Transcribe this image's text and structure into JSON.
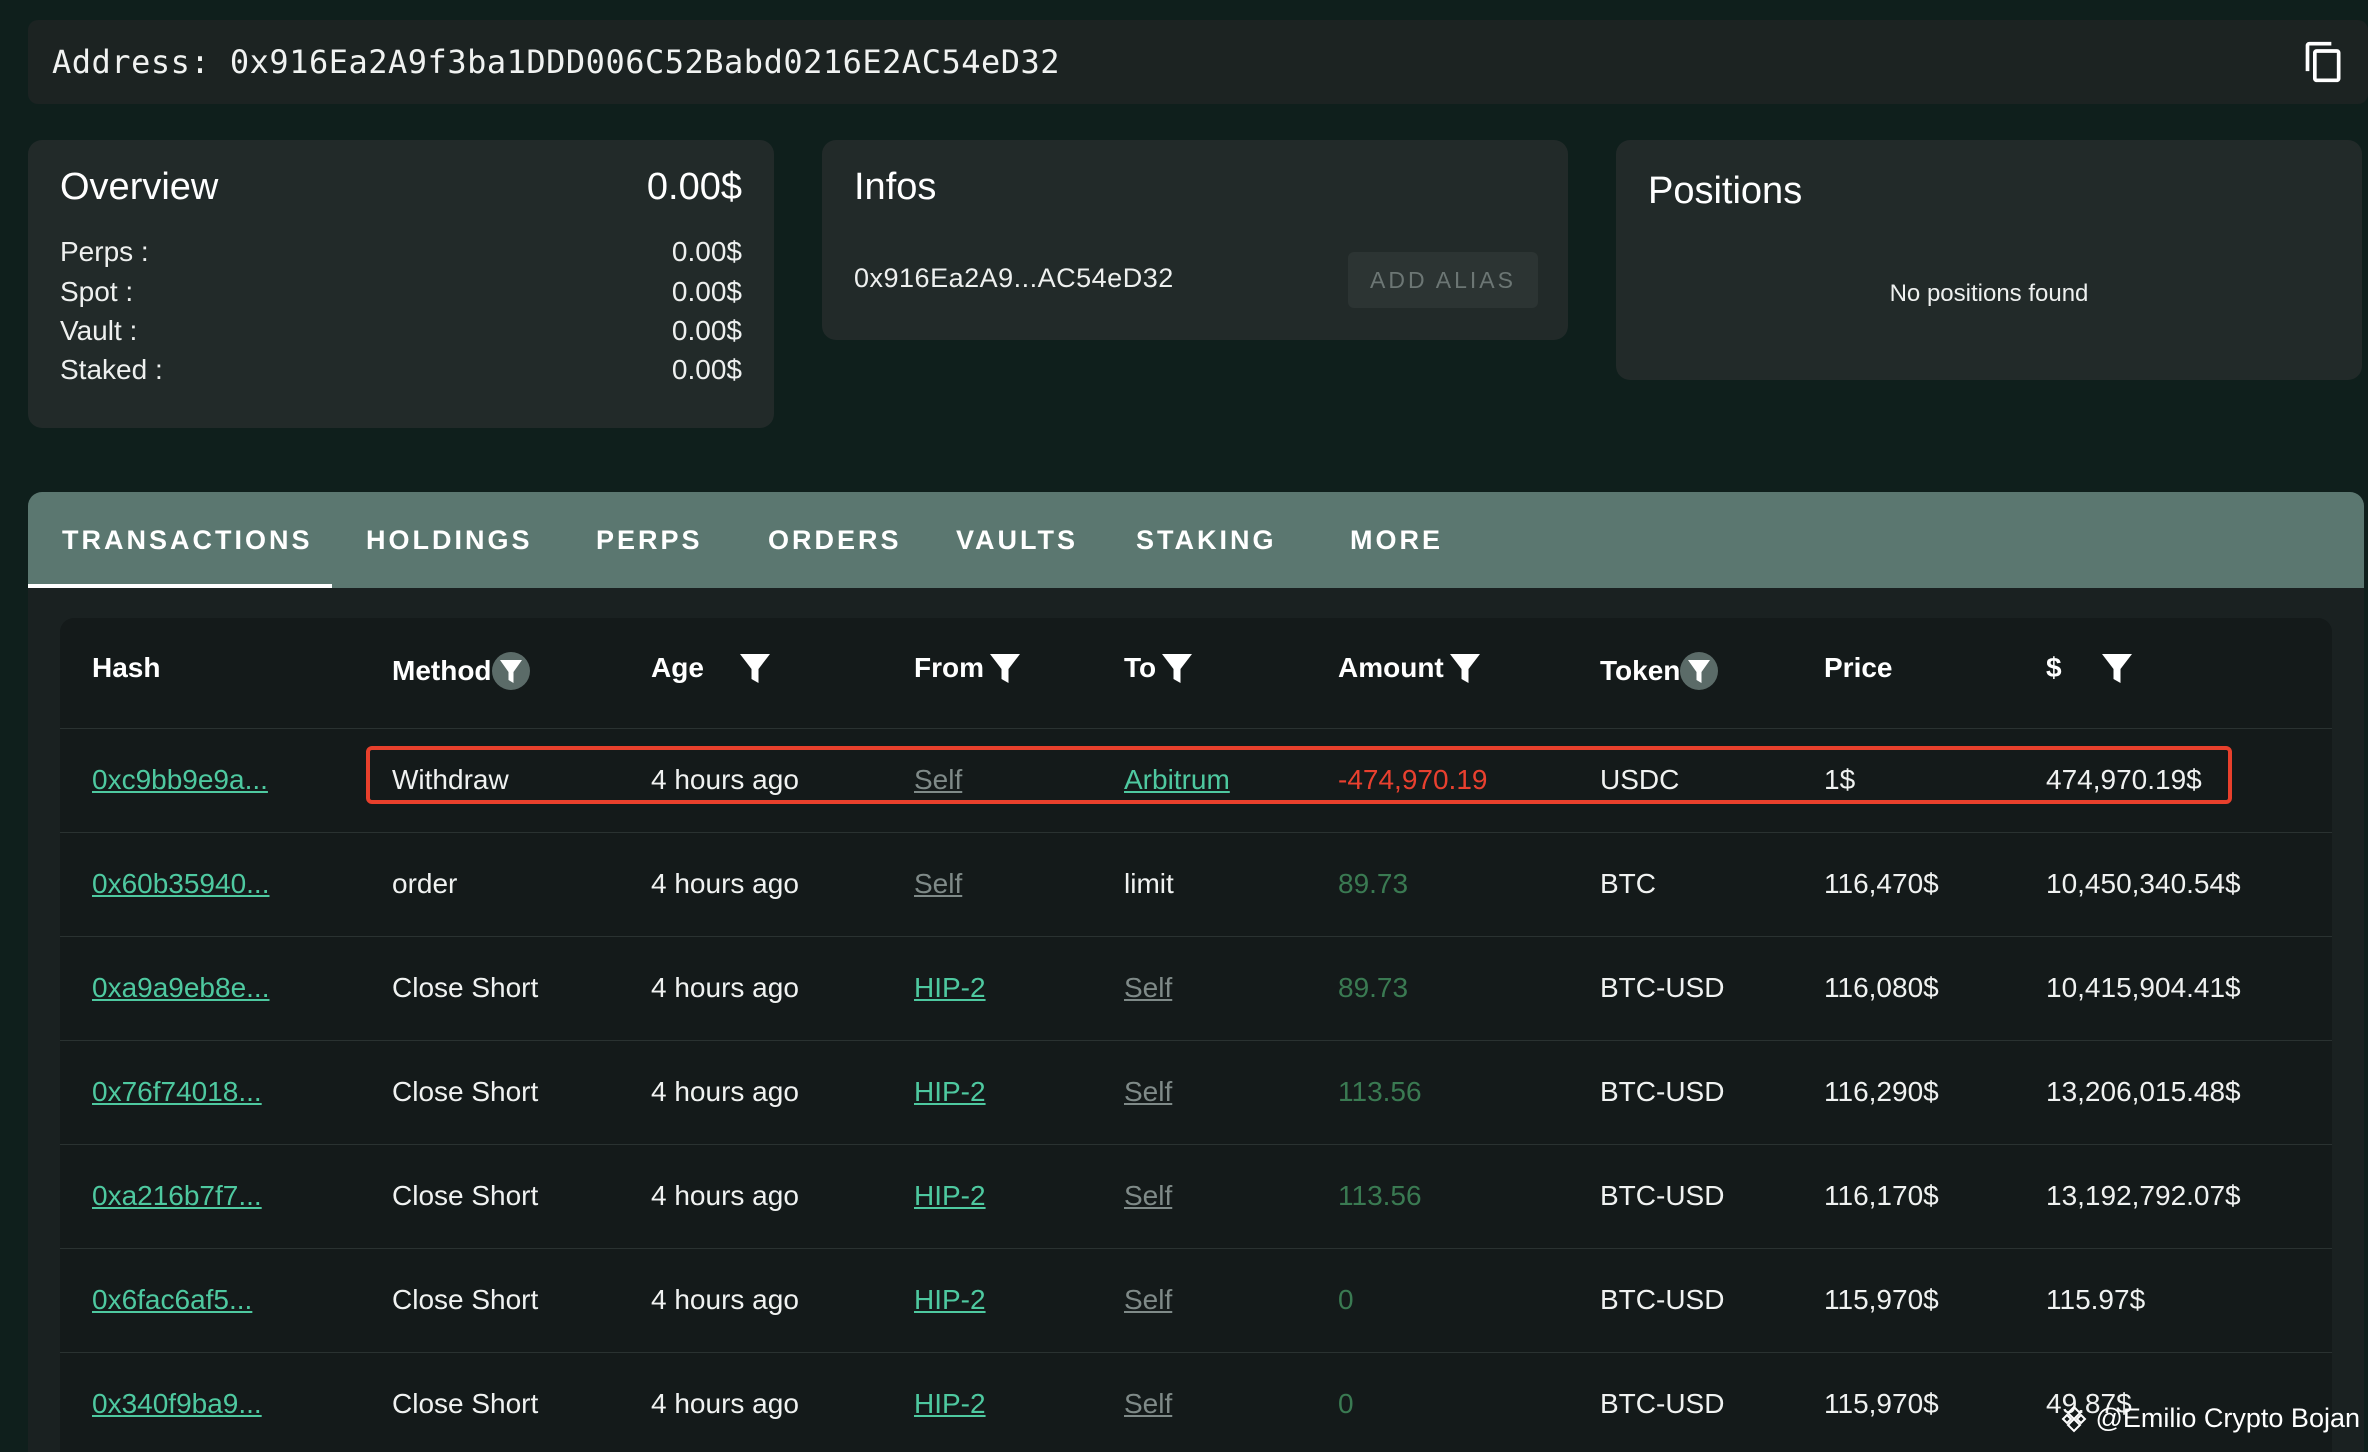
{
  "address_bar": {
    "label": "Address: 0x916Ea2A9f3ba1DDD006C52Babd0216E2AC54eD32",
    "copy_icon": "copy-icon"
  },
  "overview": {
    "title": "Overview",
    "total": "0.00$",
    "rows": [
      {
        "label": "Perps :",
        "value": "0.00$"
      },
      {
        "label": "Spot :",
        "value": "0.00$"
      },
      {
        "label": "Vault :",
        "value": "0.00$"
      },
      {
        "label": "Staked :",
        "value": "0.00$"
      }
    ]
  },
  "infos": {
    "title": "Infos",
    "short_address": "0x916Ea2A9...AC54eD32",
    "alias_button": "ADD ALIAS"
  },
  "positions": {
    "title": "Positions",
    "empty_text": "No positions found"
  },
  "tabs": [
    "TRANSACTIONS",
    "HOLDINGS",
    "PERPS",
    "ORDERS",
    "VAULTS",
    "STAKING",
    "MORE"
  ],
  "active_tab": "TRANSACTIONS",
  "table": {
    "columns": [
      "Hash",
      "Method",
      "Age",
      "From",
      "To",
      "Amount",
      "Token",
      "Price",
      "$"
    ],
    "rows": [
      {
        "hash": "0xc9bb9e9a...",
        "method": "Withdraw",
        "age": "4 hours ago",
        "from": "Self",
        "to": "Arbitrum",
        "amount": "-474,970.19",
        "token": "USDC",
        "price": "1$",
        "usd": "474,970.19$"
      },
      {
        "hash": "0x60b35940...",
        "method": "order",
        "age": "4 hours ago",
        "from": "Self",
        "to": "limit",
        "amount": "89.73",
        "token": "BTC",
        "price": "116,470$",
        "usd": "10,450,340.54$"
      },
      {
        "hash": "0xa9a9eb8e...",
        "method": "Close Short",
        "age": "4 hours ago",
        "from": "HIP-2",
        "to": "Self",
        "amount": "89.73",
        "token": "BTC-USD",
        "price": "116,080$",
        "usd": "10,415,904.41$"
      },
      {
        "hash": "0x76f74018...",
        "method": "Close Short",
        "age": "4 hours ago",
        "from": "HIP-2",
        "to": "Self",
        "amount": "113.56",
        "token": "BTC-USD",
        "price": "116,290$",
        "usd": "13,206,015.48$"
      },
      {
        "hash": "0xa216b7f7...",
        "method": "Close Short",
        "age": "4 hours ago",
        "from": "HIP-2",
        "to": "Self",
        "amount": "113.56",
        "token": "BTC-USD",
        "price": "116,170$",
        "usd": "13,192,792.07$"
      },
      {
        "hash": "0x6fac6af5...",
        "method": "Close Short",
        "age": "4 hours ago",
        "from": "HIP-2",
        "to": "Self",
        "amount": "0",
        "token": "BTC-USD",
        "price": "115,970$",
        "usd": "115.97$"
      },
      {
        "hash": "0x340f9ba9...",
        "method": "Close Short",
        "age": "4 hours ago",
        "from": "HIP-2",
        "to": "Self",
        "amount": "0",
        "token": "BTC-USD",
        "price": "115,970$",
        "usd": "49.87$"
      }
    ]
  },
  "watermark": "@Emilio Crypto Bojan",
  "colors": {
    "background": "#0f1f1c",
    "card": "#222a29",
    "tab_strip": "#5b7770",
    "link": "#4ec9a0",
    "negative": "#e9402f",
    "positive": "#3a7a52",
    "highlight_border": "#e8402c"
  }
}
